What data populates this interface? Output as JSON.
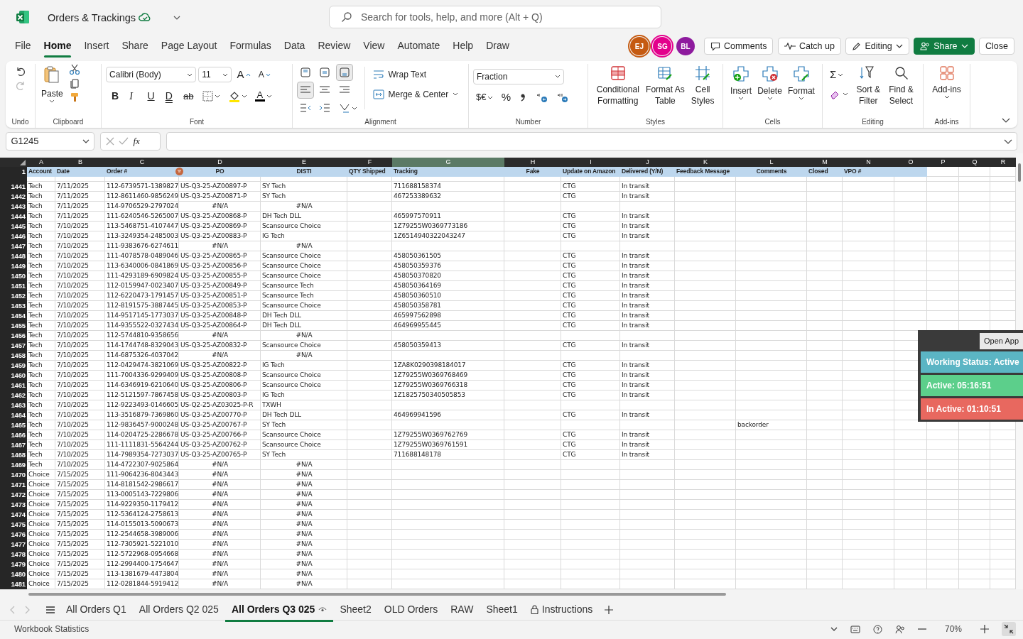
{
  "title_bar": {
    "document_title": "Orders & Trackings",
    "search_placeholder": "Search for tools, help, and more (Alt + Q)"
  },
  "menu_tabs": [
    {
      "label": "File",
      "selected": false
    },
    {
      "label": "Home",
      "selected": true
    },
    {
      "label": "Insert",
      "selected": false
    },
    {
      "label": "Share",
      "selected": false
    },
    {
      "label": "Page Layout",
      "selected": false
    },
    {
      "label": "Formulas",
      "selected": false
    },
    {
      "label": "Data",
      "selected": false
    },
    {
      "label": "Review",
      "selected": false
    },
    {
      "label": "View",
      "selected": false
    },
    {
      "label": "Automate",
      "selected": false
    },
    {
      "label": "Help",
      "selected": false
    },
    {
      "label": "Draw",
      "selected": false
    }
  ],
  "collaborators": [
    {
      "initials": "EJ",
      "color": "#c55a11",
      "present": true
    },
    {
      "initials": "SG",
      "color": "#e3008c",
      "present": true
    },
    {
      "initials": "BL",
      "color": "#8e1b9e",
      "present": false
    }
  ],
  "header_buttons": [
    "Comments",
    "Catch up",
    "Editing",
    "Share",
    "Close"
  ],
  "ribbon": {
    "undo_label": "Undo",
    "paste": "Paste",
    "clipboard_label": "Clipboard",
    "font_family": "Calibri (Body)",
    "font_size": "11",
    "grow_font": "A",
    "shrink_font": "A",
    "format_glyphs": [
      "B",
      "I",
      "U",
      "D",
      "ab"
    ],
    "font_color_glyph": "A",
    "font_label": "Font",
    "vertical_align": [
      {
        "selected": false
      },
      {
        "selected": false
      },
      {
        "selected": true
      }
    ],
    "horizontal_align": [
      {
        "selected": true
      },
      {
        "selected": false
      },
      {
        "selected": false
      }
    ],
    "wrap_text": "Wrap Text",
    "merge_center": "Merge & Center",
    "alignment_label": "Alignment",
    "number_format": "Fraction",
    "currency": "$€",
    "percent": "%",
    "number_label": "Number",
    "conditional_formatting": "Conditional Formatting",
    "format_as_table": "Format As Table",
    "cell_styles": "Cell Styles",
    "styles_label": "Styles",
    "insert": "Insert",
    "delete": "Delete",
    "format": "Format",
    "cells_label": "Cells",
    "autosum": "Σ",
    "sort_filter": "Sort & Filter",
    "find_select": "Find & Select",
    "editing_label": "Editing",
    "add_ins": "Add-ins",
    "add_ins_label": "Add-ins"
  },
  "formula_bar": {
    "name_box": "G1245",
    "function_symbol": "fx"
  },
  "grid": {
    "columns": [
      {
        "letter": "A",
        "selected": false
      },
      {
        "letter": "B",
        "selected": false
      },
      {
        "letter": "C",
        "selected": false
      },
      {
        "letter": "D",
        "selected": false
      },
      {
        "letter": "E",
        "selected": false
      },
      {
        "letter": "F",
        "selected": false
      },
      {
        "letter": "G",
        "selected": true
      },
      {
        "letter": "H",
        "selected": false
      },
      {
        "letter": "I",
        "selected": false
      },
      {
        "letter": "J",
        "selected": false
      },
      {
        "letter": "K",
        "selected": false
      },
      {
        "letter": "L",
        "selected": false
      },
      {
        "letter": "M",
        "selected": false
      },
      {
        "letter": "N",
        "selected": false
      },
      {
        "letter": "O",
        "selected": false
      },
      {
        "letter": "P",
        "selected": false
      },
      {
        "letter": "Q",
        "selected": false
      },
      {
        "letter": "R",
        "selected": false
      }
    ],
    "header_row": {
      "row": "1",
      "cells": [
        "Account",
        "Date",
        "Order #",
        "PO",
        "DISTI",
        "QTY Shipped",
        "Tracking",
        "Fake",
        "Update on Amazon",
        "Delivered (Y/N)",
        "Feedback Message",
        "Comments",
        "Closed",
        "VPO #"
      ]
    },
    "rows": [
      {
        "row": "1441",
        "account": "Tech",
        "date": "7/11/2025",
        "order": "112-6739571-1389827",
        "po": "US-Q3-25-AZ00897-P",
        "disti": "SY Tech",
        "na": false,
        "tracking": "711688158374",
        "amazon": "CTG",
        "delivered": "In transit"
      },
      {
        "row": "1442",
        "account": "Tech",
        "date": "7/11/2025",
        "order": "112-8611460-9856249",
        "po": "US-Q3-25-AZ00871-P",
        "disti": "SY Tech",
        "na": false,
        "tracking": "467253389632",
        "amazon": "CTG",
        "delivered": "In transit"
      },
      {
        "row": "1443",
        "account": "Tech",
        "date": "7/11/2025",
        "order": "114-9706529-2797024",
        "po": "#N/A",
        "disti": "#N/A",
        "na": true
      },
      {
        "row": "1444",
        "account": "Tech",
        "date": "7/11/2025",
        "order": "111-6240546-5265007",
        "po": "US-Q3-25-AZ00868-P",
        "disti": "DH Tech DLL",
        "na": false,
        "tracking": "465997570911",
        "amazon": "CTG",
        "delivered": "In transit"
      },
      {
        "row": "1445",
        "account": "Tech",
        "date": "7/10/2025",
        "order": "113-5468751-4107447",
        "po": "US-Q3-25-AZ00869-P",
        "disti": "Scansource Choice",
        "na": false,
        "tracking": "1Z79255W0369773186",
        "amazon": "CTG",
        "delivered": "In transit"
      },
      {
        "row": "1446",
        "account": "Tech",
        "date": "7/10/2025",
        "order": "113-3249354-2485003",
        "po": "US-Q3-25-AZ00883-P",
        "disti": "IG Tech",
        "na": false,
        "tracking": "1Z6514940322043247",
        "amazon": "CTG",
        "delivered": "In transit"
      },
      {
        "row": "1447",
        "account": "Tech",
        "date": "7/10/2025",
        "order": "111-9383676-6274611",
        "po": "#N/A",
        "disti": "#N/A",
        "na": true
      },
      {
        "row": "1448",
        "account": "Tech",
        "date": "7/10/2025",
        "order": "111-4078578-0489046",
        "po": "US-Q3-25-AZ00865-P",
        "disti": "Scansource Choice",
        "na": false,
        "tracking": "458050361505",
        "amazon": "CTG",
        "delivered": "In transit"
      },
      {
        "row": "1449",
        "account": "Tech",
        "date": "7/10/2025",
        "order": "113-6340006-0841869",
        "po": "US-Q3-25-AZ00856-P",
        "disti": "Scansource Choice",
        "na": false,
        "tracking": "458050359376",
        "amazon": "CTG",
        "delivered": "In transit"
      },
      {
        "row": "1450",
        "account": "Tech",
        "date": "7/10/2025",
        "order": "111-4293189-6909824",
        "po": "US-Q3-25-AZ00855-P",
        "disti": "Scansource Choice",
        "na": false,
        "tracking": "458050370820",
        "amazon": "CTG",
        "delivered": "In transit"
      },
      {
        "row": "1451",
        "account": "Tech",
        "date": "7/10/2025",
        "order": "112-0159947-0023407",
        "po": "US-Q3-25-AZ00849-P",
        "disti": "Scansource Tech",
        "na": false,
        "tracking": "458050364169",
        "amazon": "CTG",
        "delivered": "In transit"
      },
      {
        "row": "1452",
        "account": "Tech",
        "date": "7/10/2025",
        "order": "112-6220473-1791457",
        "po": "US-Q3-25-AZ00851-P",
        "disti": "Scansource Tech",
        "na": false,
        "tracking": "458050360510",
        "amazon": "CTG",
        "delivered": "In transit"
      },
      {
        "row": "1453",
        "account": "Tech",
        "date": "7/10/2025",
        "order": "112-8191575-3887445",
        "po": "US-Q3-25-AZ00853-P",
        "disti": "Scansource Choice",
        "na": false,
        "tracking": "458050358781",
        "amazon": "CTG",
        "delivered": "In transit"
      },
      {
        "row": "1454",
        "account": "Tech",
        "date": "7/10/2025",
        "order": "114-9517145-1773037",
        "po": "US-Q3-25-AZ00848-P",
        "disti": "DH Tech DLL",
        "na": false,
        "tracking": "465997562898",
        "amazon": "CTG",
        "delivered": "In transit"
      },
      {
        "row": "1455",
        "account": "Tech",
        "date": "7/10/2025",
        "order": "114-9355522-0327434",
        "po": "US-Q3-25-AZ00864-P",
        "disti": "DH Tech DLL",
        "na": false,
        "tracking": "464969955445",
        "amazon": "CTG",
        "delivered": "In transit"
      },
      {
        "row": "1456",
        "account": "Tech",
        "date": "7/10/2025",
        "order": "112-5744810-9358656",
        "po": "#N/A",
        "disti": "#N/A",
        "na": true
      },
      {
        "row": "1457",
        "account": "Tech",
        "date": "7/10/2025",
        "order": "114-1744748-8329043",
        "po": "US-Q3-25-AZ00832-P",
        "disti": "Scansource Choice",
        "na": false,
        "tracking": "458050359413",
        "amazon": "CTG",
        "delivered": "In transit"
      },
      {
        "row": "1458",
        "account": "Tech",
        "date": "7/10/2025",
        "order": "114-6875326-4037042",
        "po": "#N/A",
        "disti": "#N/A",
        "na": true
      },
      {
        "row": "1459",
        "account": "Tech",
        "date": "7/10/2025",
        "order": "112-0429474-3821069",
        "po": "US-Q3-25-AZ00822-P",
        "disti": "IG Tech",
        "na": false,
        "tracking": "1ZA8K0290398184017",
        "amazon": "CTG",
        "delivered": "In transit"
      },
      {
        "row": "1460",
        "account": "Tech",
        "date": "7/10/2025",
        "order": "111-7004336-9299409",
        "po": "US-Q3-25-AZ00808-P",
        "disti": "Scansource Choice",
        "na": false,
        "tracking": "1Z79255W0369768469",
        "amazon": "CTG",
        "delivered": "In transit"
      },
      {
        "row": "1461",
        "account": "Tech",
        "date": "7/10/2025",
        "order": "114-6346919-6210640",
        "po": "US-Q3-25-AZ00806-P",
        "disti": "Scansource Choice",
        "na": false,
        "tracking": "1Z79255W0369766318",
        "amazon": "CTG",
        "delivered": "In transit"
      },
      {
        "row": "1462",
        "account": "Tech",
        "date": "7/10/2025",
        "order": "112-5121597-7867458",
        "po": "US-Q3-25-AZ00803-P",
        "disti": "IG Tech",
        "na": false,
        "tracking": "1Z1825750340505853",
        "amazon": "CTG",
        "delivered": "In transit"
      },
      {
        "row": "1463",
        "account": "Tech",
        "date": "7/10/2025",
        "order": "112-9223493-0146605",
        "po": "US-Q2-25-AZ03025-P-R",
        "disti": "TXWH",
        "na": false
      },
      {
        "row": "1464",
        "account": "Tech",
        "date": "7/10/2025",
        "order": "113-3516879-7369860",
        "po": "US-Q3-25-AZ00770-P",
        "disti": "DH Tech DLL",
        "na": false,
        "tracking": "464969941596",
        "amazon": "CTG",
        "delivered": "In transit"
      },
      {
        "row": "1465",
        "account": "Tech",
        "date": "7/10/2025",
        "order": "112-9836457-9000248",
        "po": "US-Q3-25-AZ00767-P",
        "disti": "SY Tech",
        "na": false,
        "comments": "backorder"
      },
      {
        "row": "1466",
        "account": "Tech",
        "date": "7/10/2025",
        "order": "114-0204725-2286678",
        "po": "US-Q3-25-AZ00766-P",
        "disti": "Scansource Choice",
        "na": false,
        "tracking": "1Z79255W0369762769",
        "amazon": "CTG",
        "delivered": "In transit"
      },
      {
        "row": "1467",
        "account": "Tech",
        "date": "7/10/2025",
        "order": "111-1111831-5564244",
        "po": "US-Q3-25-AZ00762-P",
        "disti": "Scansource Choice",
        "na": false,
        "tracking": "1Z79255W0369761591",
        "amazon": "CTG",
        "delivered": "In transit"
      },
      {
        "row": "1468",
        "account": "Tech",
        "date": "7/10/2025",
        "order": "114-7989354-7273037",
        "po": "US-Q3-25-AZ00765-P",
        "disti": "SY Tech",
        "na": false,
        "tracking": "711688148178",
        "amazon": "CTG",
        "delivered": "In transit"
      },
      {
        "row": "1469",
        "account": "Tech",
        "date": "7/10/2025",
        "order": "114-4722307-9025864",
        "po": "#N/A",
        "disti": "#N/A",
        "na": true
      },
      {
        "row": "1470",
        "account": "Choice",
        "date": "7/15/2025",
        "order": "111-9064236-8043443",
        "po": "#N/A",
        "disti": "#N/A",
        "na": true
      },
      {
        "row": "1471",
        "account": "Choice",
        "date": "7/15/2025",
        "order": "114-8181542-2986617",
        "po": "#N/A",
        "disti": "#N/A",
        "na": true
      },
      {
        "row": "1472",
        "account": "Choice",
        "date": "7/15/2025",
        "order": "113-0005143-7229806",
        "po": "#N/A",
        "disti": "#N/A",
        "na": true
      },
      {
        "row": "1473",
        "account": "Choice",
        "date": "7/15/2025",
        "order": "114-9229350-1179412",
        "po": "#N/A",
        "disti": "#N/A",
        "na": true
      },
      {
        "row": "1474",
        "account": "Choice",
        "date": "7/15/2025",
        "order": "112-5364124-2758613",
        "po": "#N/A",
        "disti": "#N/A",
        "na": true
      },
      {
        "row": "1475",
        "account": "Choice",
        "date": "7/15/2025",
        "order": "114-0155013-5090673",
        "po": "#N/A",
        "disti": "#N/A",
        "na": true
      },
      {
        "row": "1476",
        "account": "Choice",
        "date": "7/15/2025",
        "order": "112-2544658-3989006",
        "po": "#N/A",
        "disti": "#N/A",
        "na": true
      },
      {
        "row": "1477",
        "account": "Choice",
        "date": "7/15/2025",
        "order": "112-7305921-5221010",
        "po": "#N/A",
        "disti": "#N/A",
        "na": true
      },
      {
        "row": "1478",
        "account": "Choice",
        "date": "7/15/2025",
        "order": "112-5722968-0954668",
        "po": "#N/A",
        "disti": "#N/A",
        "na": true
      },
      {
        "row": "1479",
        "account": "Choice",
        "date": "7/15/2025",
        "order": "112-2994400-1754647",
        "po": "#N/A",
        "disti": "#N/A",
        "na": true
      },
      {
        "row": "1480",
        "account": "Choice",
        "date": "7/15/2025",
        "order": "113-1381679-4473804",
        "po": "#N/A",
        "disti": "#N/A",
        "na": true
      },
      {
        "row": "1481",
        "account": "Choice",
        "date": "7/15/2025",
        "order": "112-0281844-5919412",
        "po": "#N/A",
        "disti": "#N/A",
        "na": true
      }
    ]
  },
  "timer_widget": {
    "open_app": "Open App",
    "status": "Working Status: Active",
    "active": "Active: 05:16:51",
    "inactive": "In Active: 01:10:51"
  },
  "sheet_tabs": [
    {
      "label": "All Orders Q1",
      "selected": false,
      "locked": false
    },
    {
      "label": "All Orders Q2 025",
      "selected": false,
      "locked": false
    },
    {
      "label": "All Orders Q3 025",
      "selected": true,
      "locked": false
    },
    {
      "label": "Sheet2",
      "selected": false,
      "locked": false
    },
    {
      "label": "OLD Orders",
      "selected": false,
      "locked": false
    },
    {
      "label": "RAW",
      "selected": false,
      "locked": false
    },
    {
      "label": "Sheet1",
      "selected": false,
      "locked": false
    },
    {
      "label": "Instructions",
      "selected": false,
      "locked": true
    }
  ],
  "status_bar": {
    "workbook_statistics": "Workbook Statistics",
    "zoom": "70%"
  }
}
